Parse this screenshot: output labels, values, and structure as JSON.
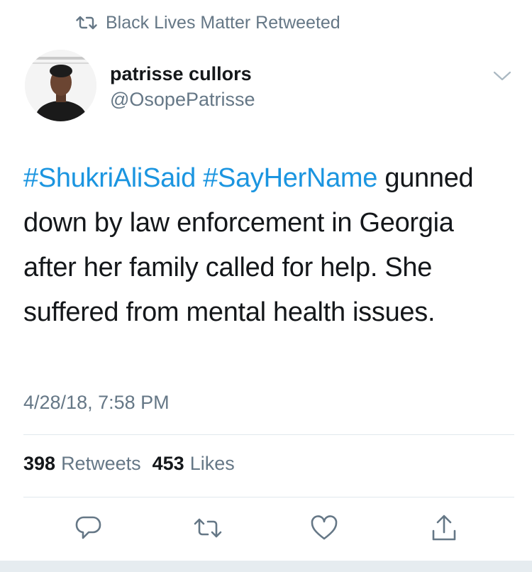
{
  "retweet_banner": {
    "icon": "retweet-icon",
    "text": "Black Lives Matter Retweeted"
  },
  "author": {
    "avatar": "avatar",
    "name": "patrisse cullors",
    "handle": "@OsopePatrisse"
  },
  "menu": {
    "icon": "chevron-down-icon"
  },
  "tweet": {
    "hashtags": [
      "#ShukriAliSaid",
      "#SayHerName"
    ],
    "body": "gunned down by law enforcement in Georgia after her family called for help. She suffered from mental health issues."
  },
  "timestamp": "4/28/18, 7:58 PM",
  "stats": {
    "retweets_count": "398",
    "retweets_label": "Retweets",
    "likes_count": "453",
    "likes_label": "Likes"
  },
  "actions": [
    {
      "name": "reply",
      "icon": "reply-icon"
    },
    {
      "name": "retweet",
      "icon": "retweet-icon"
    },
    {
      "name": "like",
      "icon": "heart-icon"
    },
    {
      "name": "share",
      "icon": "share-icon"
    }
  ],
  "colors": {
    "link": "#1b95e0",
    "muted": "#657786",
    "text": "#14171a",
    "divider": "#e1e8ed"
  }
}
